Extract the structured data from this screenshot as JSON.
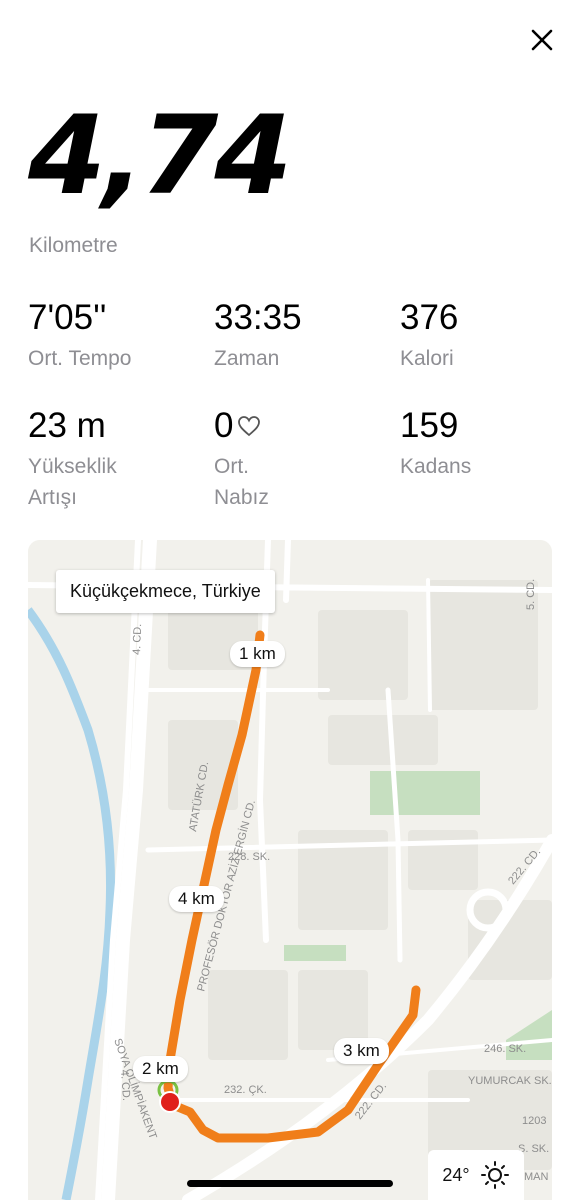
{
  "summary": {
    "distance": "4,74",
    "distance_unit": "Kilometre"
  },
  "stats": [
    {
      "value": "7'05''",
      "label": "Ort. Tempo"
    },
    {
      "value": "33:35",
      "label": "Zaman"
    },
    {
      "value": "376",
      "label": "Kalori"
    },
    {
      "value": "23 m",
      "label": "Yükseklik\nArtışı"
    },
    {
      "value": "0",
      "label": "Ort.\nNabız",
      "icon": "heart-icon"
    },
    {
      "value": "159",
      "label": "Kadans"
    }
  ],
  "map": {
    "location": "Küçükçekmece, Türkiye",
    "km_markers": [
      "1 km",
      "2 km",
      "3 km",
      "4 km"
    ],
    "route_color": "#f07e1a",
    "street_labels": [
      "4. CD.",
      "ATATÜRK CD.",
      "PROFESÖR DOKTOR AZİZ ERGİN CD.",
      "228. SK.",
      "222. CD.",
      "232. ÇK.",
      "246. SK.",
      "YUMURCAK SK.",
      "1203",
      "5. CD.",
      "SOYA OLİMPİAKENT",
      "S. SK.",
      "MAN"
    ],
    "weather": {
      "temperature": "24°",
      "icon": "sun-icon"
    }
  },
  "colors": {
    "label_gray": "#8e8e93",
    "end_marker": "#e0201b",
    "water": "#a9d3ea",
    "park": "#c6dfc0"
  }
}
